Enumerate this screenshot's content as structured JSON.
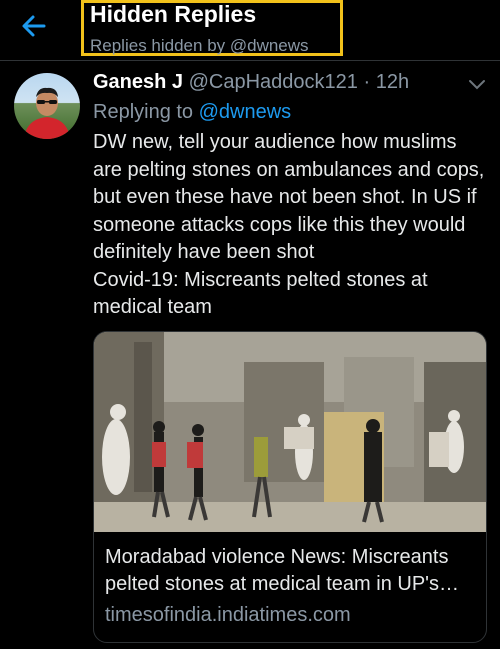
{
  "header": {
    "title": "Hidden Replies",
    "subtitle": "Replies hidden by @dwnews",
    "back_icon": "arrow-left-icon",
    "accent": "#1d9bf0",
    "highlight": "#f2c21b"
  },
  "tweet": {
    "name": "Ganesh J",
    "handle": "@CapHaddock121",
    "separator": "·",
    "time": "12h",
    "replying_prefix": "Replying to",
    "replying_to": "@dwnews",
    "body_lines": [
      "DW new, tell your audience how muslims are pelting stones on ambulances and cops, but even these have not been shot. In US if someone attacks cops like this they would definitely have been shot",
      "Covid-19: Miscreants pelted stones at medical team"
    ],
    "card": {
      "title": "Moradabad violence News: Miscreants pelted stones at medical team in UP's…",
      "domain": "timesofindia.indiatimes.com"
    }
  }
}
